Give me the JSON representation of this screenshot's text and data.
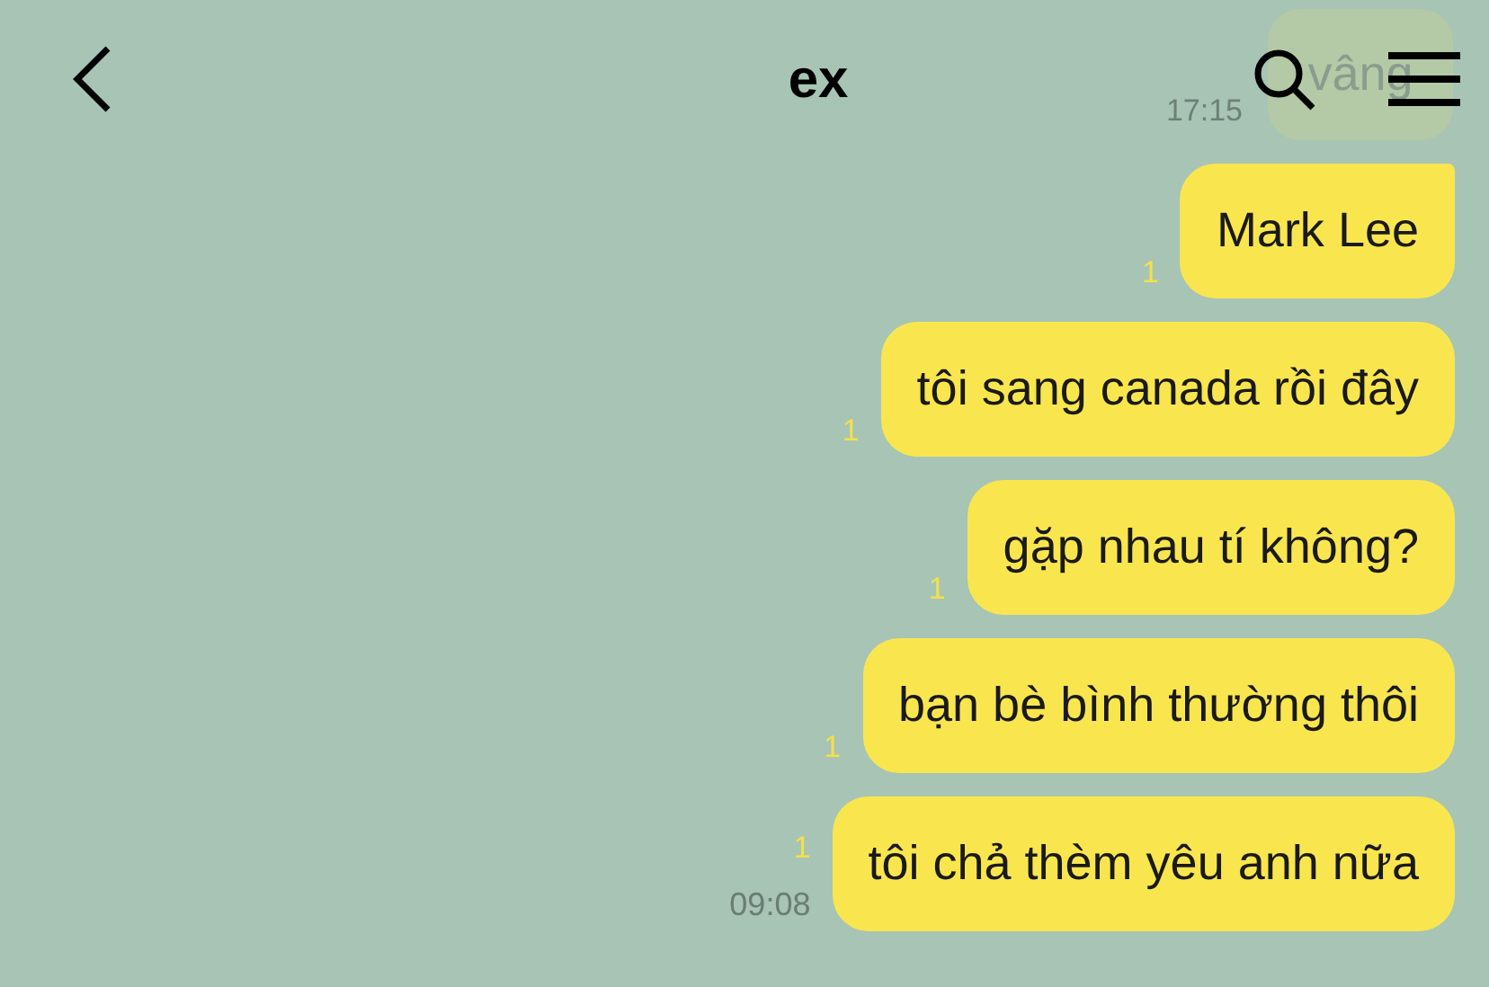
{
  "header": {
    "title": "ex"
  },
  "faded_message": {
    "text": "vâng",
    "time": "17:15"
  },
  "messages": [
    {
      "text": "Mark Lee",
      "unread": "1",
      "tail": true
    },
    {
      "text": "tôi sang canada rồi đây",
      "unread": "1",
      "tail": false
    },
    {
      "text": "gặp nhau tí không?",
      "unread": "1",
      "tail": false
    },
    {
      "text": "bạn bè bình thường thôi",
      "unread": "1",
      "tail": false
    },
    {
      "text": "tôi chả thèm yêu anh nữa",
      "unread": "1",
      "time": "09:08",
      "tail": false
    }
  ]
}
